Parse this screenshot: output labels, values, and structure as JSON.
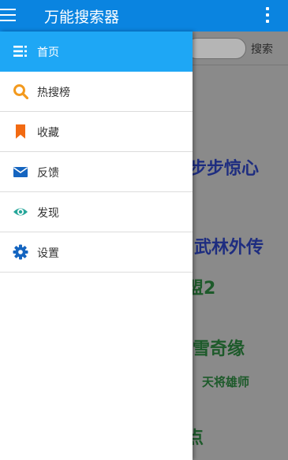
{
  "appbar": {
    "title": "万能搜索器"
  },
  "background": {
    "search_button": "搜索",
    "results": [
      {
        "text": "步步惊心",
        "color": "#1e2d80"
      },
      {
        "text": "武林外传",
        "color": "#1e2d80"
      },
      {
        "text": "盟2",
        "color": "#1d5a2a"
      },
      {
        "text": "雪奇缘",
        "color": "#1d5a2a"
      },
      {
        "text": "天将雄师",
        "color": "#1d5a2a"
      },
      {
        "text": "点",
        "color": "#1d5a2a"
      }
    ]
  },
  "drawer": {
    "items": [
      {
        "label": "首页",
        "icon": "list-icon",
        "active": true
      },
      {
        "label": "热搜榜",
        "icon": "search-icon",
        "active": false
      },
      {
        "label": "收藏",
        "icon": "bookmark-icon",
        "active": false
      },
      {
        "label": "反馈",
        "icon": "mail-icon",
        "active": false
      },
      {
        "label": "发现",
        "icon": "eye-icon",
        "active": false
      },
      {
        "label": "设置",
        "icon": "gear-icon",
        "active": false
      }
    ]
  },
  "colors": {
    "appbar": "#0a84e0",
    "active_item": "#1ea7f5",
    "search_icon": "#f39a1e",
    "bookmark_icon": "#f26a12",
    "mail_icon": "#1565c0",
    "eye_icon": "#26a69a",
    "gear_icon": "#1565c0"
  }
}
